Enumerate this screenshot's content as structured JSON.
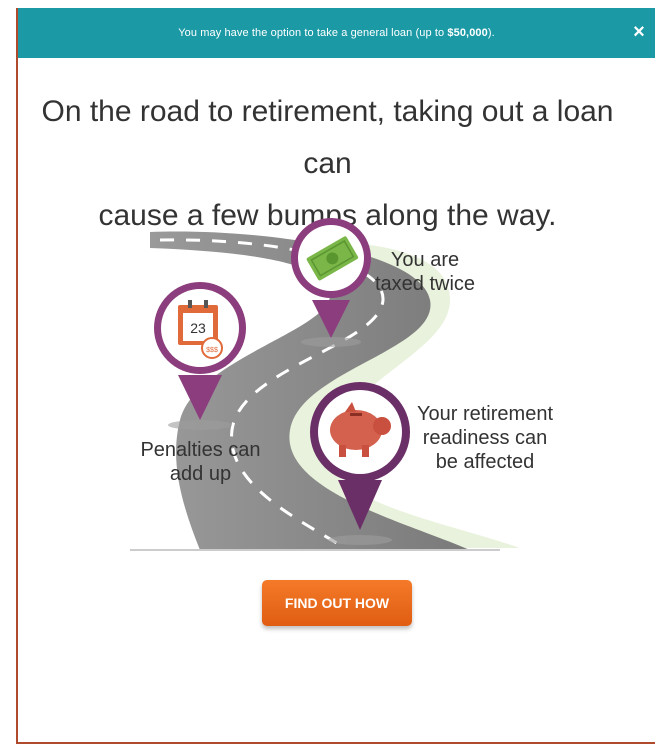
{
  "banner": {
    "text_prefix": "You may have the option to take a general loan (up to ",
    "amount": "$50,000",
    "text_suffix": ").",
    "close_label": "×"
  },
  "headline": {
    "line1": "On the road to retirement, taking out a loan can",
    "line2": "cause a few bumps along the way."
  },
  "bumps": [
    {
      "caption_line1": "Penalties can",
      "caption_line2": "add up",
      "icon": "calendar-icon",
      "icon_text": "23",
      "stamp_text": "$$$"
    },
    {
      "caption_line1": "You are",
      "caption_line2": "taxed twice",
      "icon": "money-icon"
    },
    {
      "caption_line1": "Your retirement",
      "caption_line2": "readiness can",
      "caption_line3": "be affected",
      "icon": "piggy-bank-icon"
    }
  ],
  "cta": {
    "label": "FIND OUT HOW"
  },
  "colors": {
    "banner": "#1b9aa6",
    "pin_ring": "#8b3d7d",
    "cta": "#f0701f",
    "road": "#8c8c8c"
  }
}
